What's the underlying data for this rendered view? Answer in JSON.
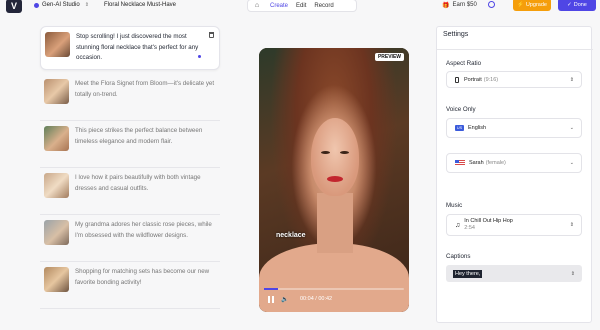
{
  "topbar": {
    "logo": "V",
    "studio": "Gen-AI Studio",
    "project_title": "Floral Necklace Must-Have",
    "modes": [
      "Create",
      "Edit",
      "Record"
    ],
    "earn": "Earn $50",
    "upgrade": "Upgrade",
    "done": "Done",
    "accent_color": "#4f46e5",
    "upgrade_color": "#f59e0b"
  },
  "script": [
    {
      "text": "Stop scrolling! I just discovered the most stunning floral necklace that's perfect for any occasion."
    },
    {
      "text": "Meet the Flora Signet from Bloom—it's delicate yet totally on-trend."
    },
    {
      "text": "This piece strikes the perfect balance between timeless elegance and modern flair."
    },
    {
      "text": "I love how it pairs beautifully with both vintage dresses and casual outfits."
    },
    {
      "text": "My grandma adores her classic rose pieces, while I'm obsessed with the wildflower designs."
    },
    {
      "text": "Shopping for matching sets has become our new favorite bonding activity!"
    }
  ],
  "video": {
    "badge": "PREVIEW",
    "caption": "necklace",
    "time": "00:04 / 00:42",
    "progress": 0.1
  },
  "settings": {
    "title": "Settings",
    "aspect_ratio_label": "Aspect Ratio",
    "aspect_ratio_value": "Portrait",
    "aspect_ratio_sub": "(9:16)",
    "voice_label": "Voice Only",
    "language_flag": "US",
    "language": "English",
    "voice_name": "Sarah",
    "voice_sub": "(female)",
    "music_label": "Music",
    "music_title": "In Chill Out Hip Hop",
    "music_duration": "2:54",
    "captions_label": "Captions",
    "captions_value": "Hey there,"
  }
}
